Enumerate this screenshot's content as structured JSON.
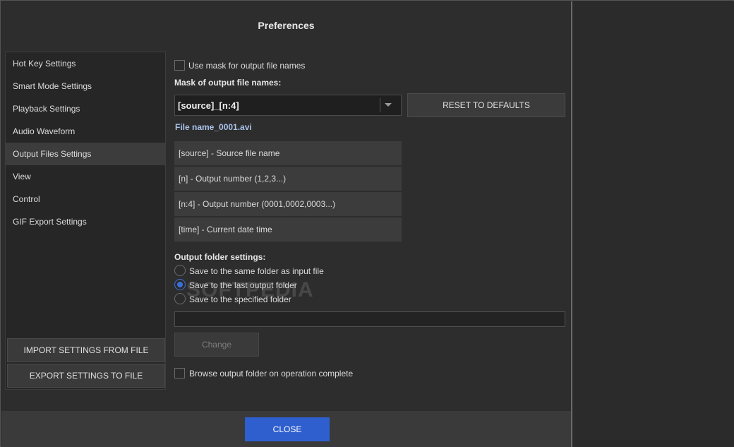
{
  "dialog": {
    "title": "Preferences"
  },
  "sidebar": {
    "items": [
      {
        "label": "Hot Key Settings"
      },
      {
        "label": "Smart Mode Settings"
      },
      {
        "label": "Playback Settings"
      },
      {
        "label": "Audio Waveform"
      },
      {
        "label": "Output Files Settings",
        "active": true
      },
      {
        "label": "View"
      },
      {
        "label": "Control"
      },
      {
        "label": "GIF Export Settings"
      }
    ],
    "import_label": "IMPORT SETTINGS FROM FILE",
    "export_label": "EXPORT SETTINGS TO FILE"
  },
  "output": {
    "use_mask_label": "Use mask for output file names",
    "use_mask_checked": false,
    "mask_heading": "Mask of output file names:",
    "mask_value": "[source]_[n:4]",
    "reset_label": "RESET TO DEFAULTS",
    "preview": "File name_0001.avi",
    "tokens": [
      "[source] - Source file name",
      "[n] - Output number (1,2,3...)",
      "[n:4] - Output number (0001,0002,0003...)",
      "[time] - Current date time"
    ],
    "folder_heading": "Output folder settings:",
    "folder_options": [
      {
        "label": "Save to the same folder as input file",
        "checked": false
      },
      {
        "label": "Save to the last output folder",
        "checked": true
      },
      {
        "label": "Save to the specified folder",
        "checked": false
      }
    ],
    "path_value": "",
    "change_label": "Change",
    "browse_label": "Browse output folder on operation complete",
    "browse_checked": false
  },
  "footer": {
    "close_label": "CLOSE"
  },
  "colors": {
    "accent": "#2f5fcf",
    "preview_text": "#a9c3ea"
  },
  "watermark": "SOFTPEDIA"
}
